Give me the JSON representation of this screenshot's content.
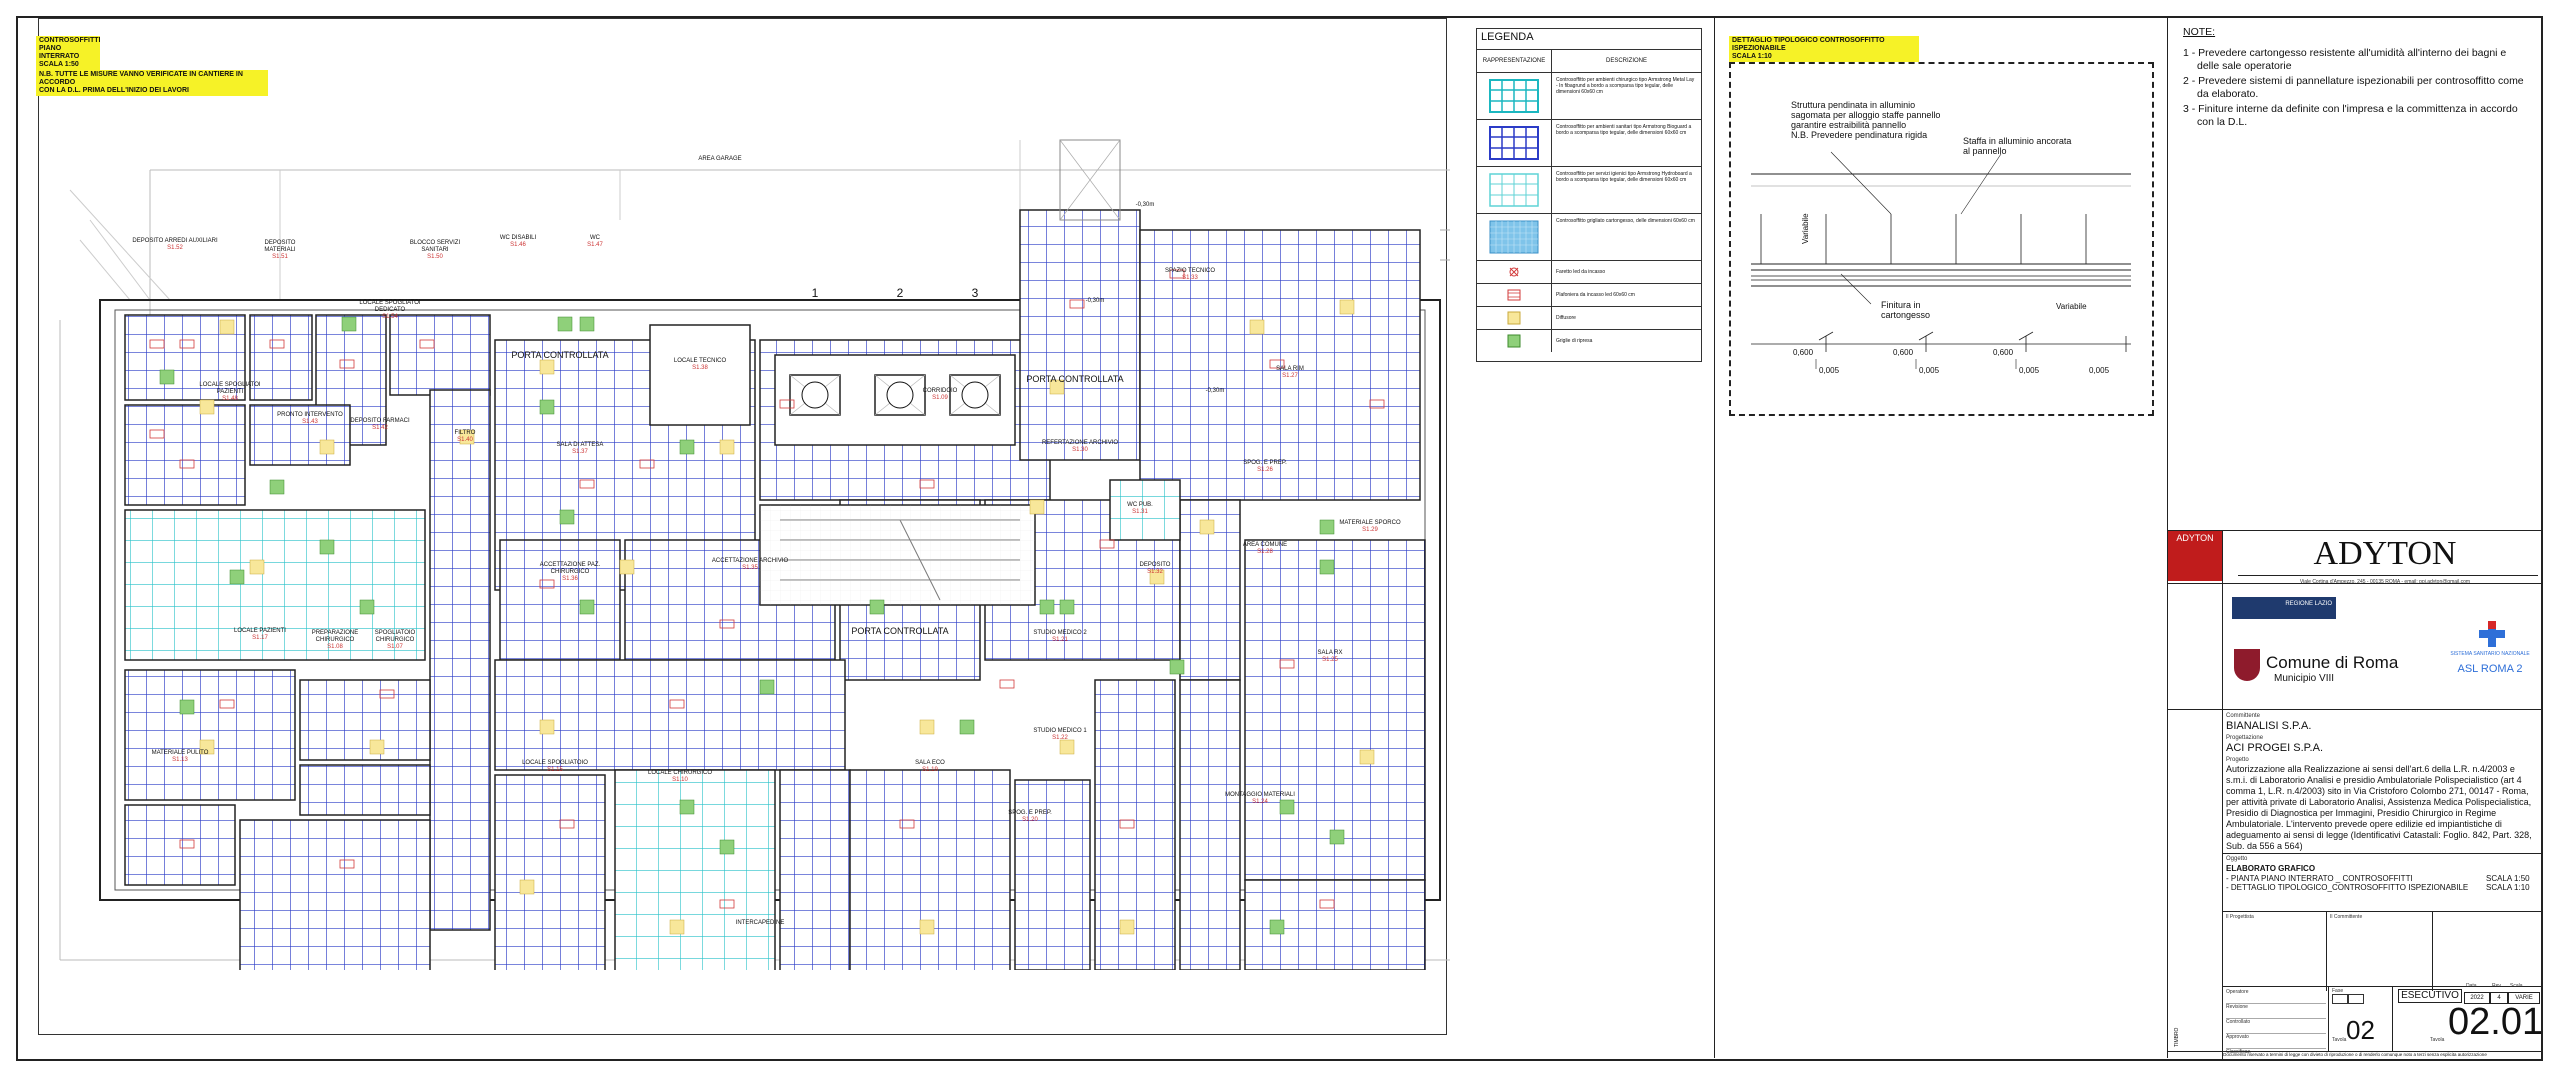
{
  "header_notes": {
    "title_lines": [
      "CONTROSOFFITTI",
      "PIANO INTERRATO",
      "SCALA 1:50"
    ],
    "warning_lines": [
      "N.B. TUTTE LE MISURE VANNO VERIFICATE IN CANTIERE IN ACCORDO",
      "CON LA D.L. PRIMA DELL'INIZIO DEI LAVORI"
    ]
  },
  "plan": {
    "area_labels": {
      "area_garage": "AREA GARAGE",
      "intercapedine": "INTERCAPEDINE",
      "locale_tecnico": "LOCALE TECNICO",
      "locale_tecnico_code": "S1.38",
      "porta_controllata": "PORTA CONTROLLATA",
      "elevators": [
        "1",
        "2",
        "3"
      ],
      "elevation_1": "-0,30m",
      "elevation_2": "-0,30m",
      "elevation_3": "-0,30m"
    },
    "rooms": [
      {
        "name": "DEPOSITO ARREDI AUXILIARI",
        "code": "S1.52"
      },
      {
        "name": "DEPOSITO MATERIALI",
        "code": "S1.51"
      },
      {
        "name": "BLOCCO SERVIZI SANITARI",
        "code": "S1.50"
      },
      {
        "name": "WC DISABILI",
        "code": "S1.46"
      },
      {
        "name": "WC",
        "code": "S1.47"
      },
      {
        "name": "LOCALE SPOGLIATOI PAZIENTI",
        "code": "S1.48"
      },
      {
        "name": "LOCALE SPOGLIATOI DEDICATO",
        "code": "S1.54"
      },
      {
        "name": "PRONTO INTERVENTO",
        "code": "S1.43"
      },
      {
        "name": "DEPOSITO FARMACI",
        "code": "S1.42"
      },
      {
        "name": "FILTRO",
        "code": "S1.40"
      },
      {
        "name": "SALA DI ATTESA",
        "code": "S1.37"
      },
      {
        "name": "CORRIDOIO",
        "code": "S1.09"
      },
      {
        "name": "ACCETTAZIONE PAZ. CHIRURGICO",
        "code": "S1.36"
      },
      {
        "name": "ACCETTAZIONE ARCHIVIO",
        "code": "S1.35"
      },
      {
        "name": "PREPARAZIONE CHIRURGICO",
        "code": "S1.08"
      },
      {
        "name": "SPOGLIATOIO CHIRURGICO",
        "code": "S1.07"
      },
      {
        "name": "LOCALE PAZIENTI",
        "code": "S1.17"
      },
      {
        "name": "LOCALE SPOGLIATOIO",
        "code": "S1.15"
      },
      {
        "name": "MATERIALE PULITO",
        "code": "S1.13"
      },
      {
        "name": "LOCALE CHIRURGICO",
        "code": "S1.10"
      },
      {
        "name": "SALA RIM",
        "code": "S1.27"
      },
      {
        "name": "SPOG. E PREP.",
        "code": "S1.26"
      },
      {
        "name": "AREA COMUNE",
        "code": "S1.28"
      },
      {
        "name": "SALA RX",
        "code": "S1.25"
      },
      {
        "name": "REFERTAZIONE ARCHIVIO",
        "code": "S1.30"
      },
      {
        "name": "SPAZIO TECNICO",
        "code": "S1.33"
      },
      {
        "name": "DEPOSITO",
        "code": "S1.32"
      },
      {
        "name": "STUDIO MEDICO 1",
        "code": "S1.22"
      },
      {
        "name": "STUDIO MEDICO 2",
        "code": "S1.21"
      },
      {
        "name": "MONTAGGIO MATERIALI",
        "code": "S1.24"
      },
      {
        "name": "SALA ECO",
        "code": "S1.19"
      },
      {
        "name": "SPOG. E PREP.",
        "code": "S1.20"
      },
      {
        "name": "WC PUB.",
        "code": "S1.31"
      },
      {
        "name": "MATERIALE SPORCO",
        "code": "S1.29"
      }
    ]
  },
  "legend": {
    "title": "LEGENDA",
    "col_representation": "RAPPRESENTAZIONE",
    "col_description": "DESCRIZIONE",
    "rows": [
      {
        "symbol": "grid-cyan-heavy",
        "description": "Controsoffitto per ambienti chirurgico tipo Armstrong Metal Lay - In fibagrund a bordo a scomparsa tipo tegular, delle dimensioni 60x60 cm"
      },
      {
        "symbol": "grid-blue",
        "description": "Controsoffitto per ambienti sanitari tipo Armstrong Bioguard a bordo a scomparsa tipo tegular, delle dimensioni 60x60 cm"
      },
      {
        "symbol": "grid-cyan",
        "description": "Controsoffitto per servizi igienici tipo Armstrong Hydroboard a bordo a scomparsa tipo tegular, delle dimensioni 60x60 cm"
      },
      {
        "symbol": "grid-solid",
        "description": "Controsoffitto grigliato cartongesso, delle dimensioni 60x60 cm"
      },
      {
        "symbol": "point",
        "description": "Faretto led da incasso"
      },
      {
        "symbol": "light",
        "description": "Plafoniera da incasso led 60x60 cm"
      },
      {
        "symbol": "diffuser",
        "description": "Diffusore"
      },
      {
        "symbol": "grille",
        "description": "Griglie di ripresa"
      }
    ]
  },
  "detail": {
    "title_lines": [
      "DETTAGLIO TIPOLOGICO CONTROSOFFITTO ISPEZIONABILE",
      "SCALA 1:10"
    ],
    "note_structure": [
      "Struttura pendinata in alluminio",
      "sagomata per alloggio staffe pannello",
      "garantire estraibilità pannello",
      "N.B. Prevedere pendinatura rigida"
    ],
    "note_bracket": [
      "Staffa in alluminio ancorata",
      "al pannello"
    ],
    "note_finish": [
      "Finitura in",
      "cartongesso"
    ],
    "label_variabile_left": "Variabile",
    "label_variabile_right": "Variabile",
    "dims_top": [
      "0,600",
      "0,600",
      "0,600"
    ],
    "dims_bottom": [
      "0,005",
      "0,005",
      "0,005",
      "0,005"
    ]
  },
  "notes": {
    "title": "NOTE:",
    "items": [
      "1 - Prevedere cartongesso resistente all'umidità all'interno dei bagni e delle sale operatorie",
      "2 - Prevedere sistemi di pannellature ispezionabili per controsoffitto come da elaborato.",
      "3 - Finiture interne da definite con l'impresa e la committenza in accordo con la D.L."
    ]
  },
  "title_block": {
    "logo_small": "ADYTON",
    "company": "ADYTON",
    "address": "Viale Cortina d'Ampezzo, 245 - 00135 ROMA - email: ppj.adyton@gmail.com",
    "regione": "REGIONE LAZIO",
    "comune": "Comune di Roma",
    "municipio": "Municipio VIII",
    "ssn": "SISTEMA SANITARIO NAZIONALE",
    "asl": "ASL ROMA 2",
    "committente_label": "Committente",
    "committente": "BIANALISI S.P.A.",
    "progettazione_label": "Progettazione",
    "progettazione": "ACI PROGEI S.P.A.",
    "progetto_label": "Progetto",
    "progetto": "Autorizzazione alla Realizzazione ai sensi dell'art.6 della L.R. n.4/2003 e s.m.i. di Laboratorio Analisi e presidio Ambulatoriale Polispecialistico (art 4 comma 1, L.R. n.4/2003) sito in Via Cristoforo Colombo 271, 00147 - Roma, per attività private di Laboratorio Analisi, Assistenza Medica Polispecialistica, Presidio di Diagnostica per Immagini, Presidio Chirurgico in Regime Ambulatoriale. L'intervento prevede opere edilizie ed impiantistiche di adeguamento ai sensi di legge (Identificativi Catastali: Foglio. 842, Part. 328, Sub. da 556 a 564)",
    "oggetto_label": "Oggetto",
    "elaborato": "ELABORATO GRAFICO",
    "line1": "- PIANTA PIANO INTERRATO _ CONTROSOFFITTI",
    "line1_scale": "SCALA 1:50",
    "line2": "- DETTAGLIO TIPOLOGICO_CONTROSOFFITTO ISPEZIONABILE",
    "line2_scale": "SCALA 1:10",
    "progettista_label": "Il Progettista",
    "committente2_label": "Il Committente",
    "rows_left": [
      "Operatore",
      "Revisione",
      "Controllato",
      "Approvato",
      "Classificaz."
    ],
    "fase_label": "Fase",
    "fase": "ESECUTIVO",
    "data_label": "Data",
    "rev_label": "Rev.",
    "scala_label": "Scala",
    "date_value": "2022",
    "rev_value": "4",
    "scale_value": "VARIE",
    "tavola_prefix": "Tavola",
    "tavola_num": "02",
    "tavola_code_label": "Tavola",
    "tavola_code": "02.01",
    "side_stamp": "TIMBRO",
    "footer": "Documento riservato a termini di legge con divieto di riproduzione o di renderlo comunque noto a terzi senza esplicita autorizzazione"
  }
}
